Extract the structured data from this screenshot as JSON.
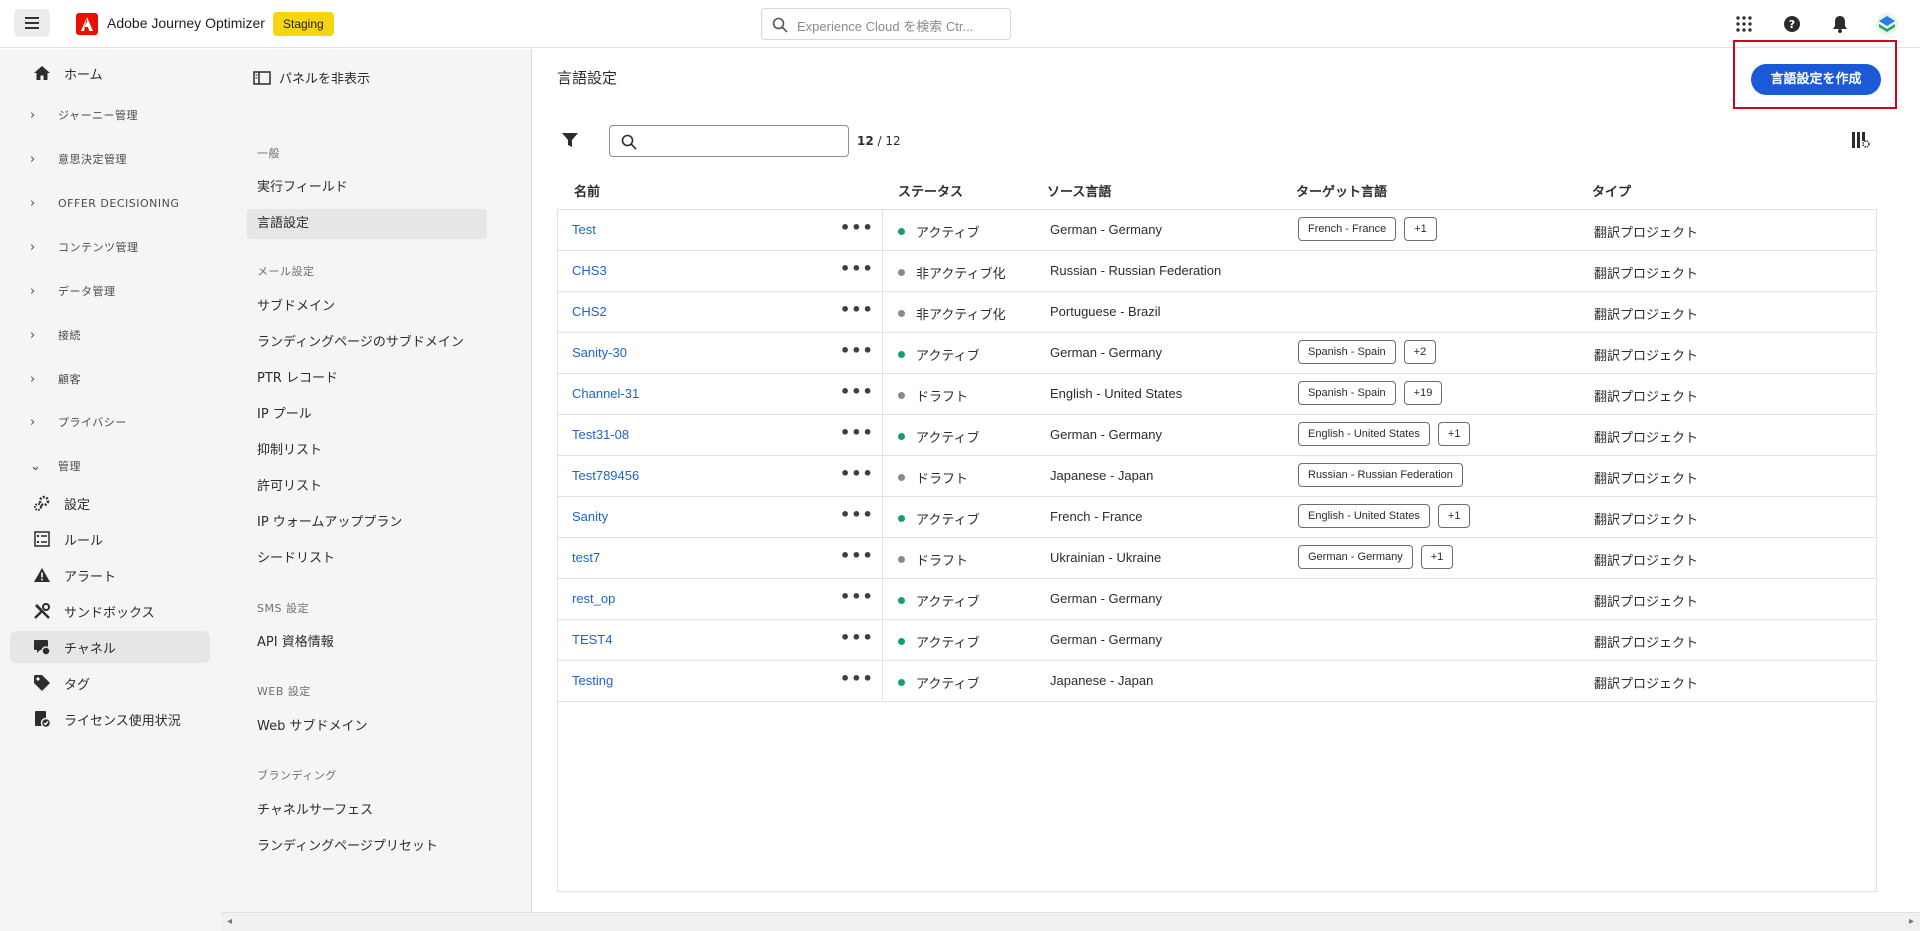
{
  "topbar": {
    "app_title": "Adobe Journey Optimizer",
    "env_badge": "Staging",
    "search_placeholder": "Experience Cloud を検索 Ctr..."
  },
  "leftnav": {
    "items": [
      {
        "label": "ホーム",
        "kind": "item",
        "icon": "home-icon"
      },
      {
        "label": "ジャーニー管理",
        "kind": "section"
      },
      {
        "label": "意思決定管理",
        "kind": "section"
      },
      {
        "label": "OFFER DECISIONING",
        "kind": "section"
      },
      {
        "label": "コンテンツ管理",
        "kind": "section"
      },
      {
        "label": "データ管理",
        "kind": "section"
      },
      {
        "label": "接続",
        "kind": "section"
      },
      {
        "label": "顧客",
        "kind": "section"
      },
      {
        "label": "プライバシー",
        "kind": "section"
      },
      {
        "label": "管理",
        "kind": "section-open"
      },
      {
        "label": "設定",
        "kind": "item",
        "icon": "gears-icon"
      },
      {
        "label": "ルール",
        "kind": "item",
        "icon": "rules-icon"
      },
      {
        "label": "アラート",
        "kind": "item",
        "icon": "alert-icon"
      },
      {
        "label": "サンドボックス",
        "kind": "item",
        "icon": "tools-icon"
      },
      {
        "label": "チャネル",
        "kind": "item",
        "icon": "channel-icon",
        "active": true
      },
      {
        "label": "タグ",
        "kind": "item",
        "icon": "tag-icon"
      },
      {
        "label": "ライセンス使用状況",
        "kind": "item",
        "icon": "license-icon"
      }
    ]
  },
  "subnav": {
    "hide_panel": "パネルを非表示",
    "groups": [
      {
        "header": "一般",
        "items": [
          "実行フィールド",
          "言語設定"
        ]
      },
      {
        "header": "メール設定",
        "items": [
          "サブドメイン",
          "ランディングページのサブドメイン",
          "PTR レコード",
          "IP プール",
          "抑制リスト",
          "許可リスト",
          "IP ウォームアッププラン",
          "シードリスト"
        ]
      },
      {
        "header": "SMS 設定",
        "items": [
          "API 資格情報"
        ]
      },
      {
        "header": "WEB 設定",
        "items": [
          "Web サブドメイン"
        ]
      },
      {
        "header": "ブランディング",
        "items": [
          "チャネルサーフェス",
          "ランディングページプリセット"
        ]
      }
    ],
    "active_item": "言語設定"
  },
  "main": {
    "title": "言語設定",
    "create_button": "言語設定を作成",
    "count_current": "12",
    "count_total": "/ 12",
    "columns": [
      "名前",
      "ステータス",
      "ソース言語",
      "ターゲット言語",
      "タイプ"
    ],
    "more_label": "•••",
    "rows": [
      {
        "name": "Test",
        "status": "アクティブ",
        "status_kind": "active",
        "source": "German - Germany",
        "targets": [
          "French - France",
          "+1"
        ],
        "type": "翻訳プロジェクト"
      },
      {
        "name": "CHS3",
        "status": "非アクティブ化",
        "status_kind": "inactive",
        "source": "Russian - Russian Federation",
        "targets": [],
        "type": "翻訳プロジェクト"
      },
      {
        "name": "CHS2",
        "status": "非アクティブ化",
        "status_kind": "inactive",
        "source": "Portuguese - Brazil",
        "targets": [],
        "type": "翻訳プロジェクト"
      },
      {
        "name": "Sanity-30",
        "status": "アクティブ",
        "status_kind": "active",
        "source": "German - Germany",
        "targets": [
          "Spanish - Spain",
          "+2"
        ],
        "type": "翻訳プロジェクト"
      },
      {
        "name": "Channel-31",
        "status": "ドラフト",
        "status_kind": "draft",
        "source": "English - United States",
        "targets": [
          "Spanish - Spain",
          "+19"
        ],
        "type": "翻訳プロジェクト"
      },
      {
        "name": "Test31-08",
        "status": "アクティブ",
        "status_kind": "active",
        "source": "German - Germany",
        "targets": [
          "English - United States",
          "+1"
        ],
        "type": "翻訳プロジェクト"
      },
      {
        "name": "Test789456",
        "status": "ドラフト",
        "status_kind": "draft",
        "source": "Japanese - Japan",
        "targets": [
          "Russian - Russian Federation"
        ],
        "type": "翻訳プロジェクト"
      },
      {
        "name": "Sanity",
        "status": "アクティブ",
        "status_kind": "active",
        "source": "French - France",
        "targets": [
          "English - United States",
          "+1"
        ],
        "type": "翻訳プロジェクト"
      },
      {
        "name": "test7",
        "status": "ドラフト",
        "status_kind": "draft",
        "source": "Ukrainian - Ukraine",
        "targets": [
          "German - Germany",
          "+1"
        ],
        "type": "翻訳プロジェクト"
      },
      {
        "name": "rest_op",
        "status": "アクティブ",
        "status_kind": "active",
        "source": "German - Germany",
        "targets": [],
        "type": "翻訳プロジェクト"
      },
      {
        "name": "TEST4",
        "status": "アクティブ",
        "status_kind": "active",
        "source": "German - Germany",
        "targets": [],
        "type": "翻訳プロジェクト"
      },
      {
        "name": "Testing",
        "status": "アクティブ",
        "status_kind": "active",
        "source": "Japanese - Japan",
        "targets": [],
        "type": "翻訳プロジェクト"
      }
    ]
  },
  "colors": {
    "accent": "#1b5ad6",
    "link": "#1d64c8",
    "active_dot": "#12a16b",
    "neutral_dot": "#8a8a8a",
    "highlight_frame": "#d6001c",
    "badge": "#f5d50d"
  }
}
